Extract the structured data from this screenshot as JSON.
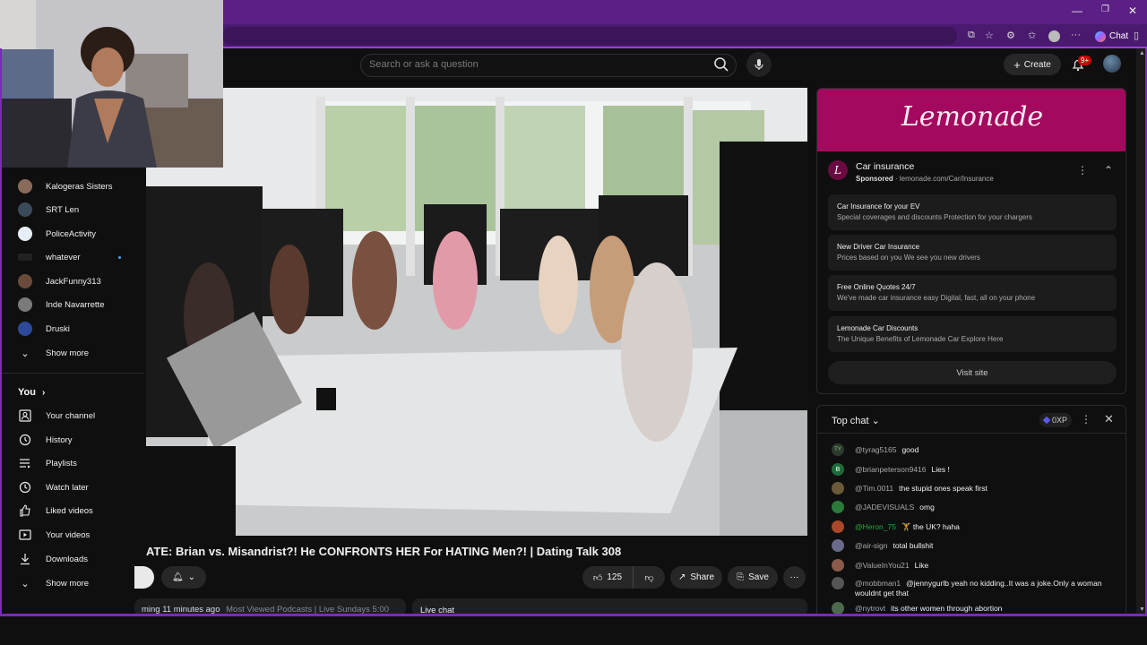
{
  "browser": {
    "chat_label": "Chat",
    "window_controls": [
      "—",
      "❐",
      "✕"
    ]
  },
  "header": {
    "search_placeholder": "Search or ask a question",
    "create_label": "Create",
    "notif_count": "9+"
  },
  "sidebar": {
    "subscriptions": [
      {
        "label": "Kalogeras Sisters",
        "color": "#8a6a5a"
      },
      {
        "label": "SRT Len",
        "color": "#3a4a5a"
      },
      {
        "label": "PoliceActivity",
        "color": "#e8eef8"
      },
      {
        "label": "whatever",
        "color": "#222222",
        "live": true
      },
      {
        "label": "JackFunny313",
        "color": "#6a4a3a"
      },
      {
        "label": "Inde Navarrette",
        "color": "#7a7a7a"
      },
      {
        "label": "Druski",
        "color": "#2b4a9a"
      }
    ],
    "show_more_1": "Show more",
    "you_heading": "You",
    "you_items": [
      {
        "label": "Your channel",
        "icon": "person-icon"
      },
      {
        "label": "History",
        "icon": "history-icon"
      },
      {
        "label": "Playlists",
        "icon": "playlists-icon"
      },
      {
        "label": "Watch later",
        "icon": "clock-icon"
      },
      {
        "label": "Liked videos",
        "icon": "thumbs-up-icon"
      },
      {
        "label": "Your videos",
        "icon": "play-box-icon"
      },
      {
        "label": "Downloads",
        "icon": "download-icon"
      }
    ],
    "show_more_2": "Show more"
  },
  "video": {
    "title": "ATE: Brian vs. Misandrist?! He CONFRONTS HER For HATING Men?! | Dating Talk 308",
    "likes": "125",
    "share_label": "Share",
    "save_label": "Save",
    "meta_time": "ming 11 minutes ago",
    "meta_tags": "Most Viewed Podcasts | Live Sundays 5:00",
    "live_chat_label": "Live chat"
  },
  "ad": {
    "brand": "Lemonade",
    "badge": "L",
    "title": "Car insurance",
    "sponsored": "Sponsored",
    "domain": "lemonade.com/Car/Insurance",
    "cards": [
      {
        "h": "Car Insurance for your EV",
        "d": "Special coverages and discounts Protection for your chargers"
      },
      {
        "h": "New Driver Car Insurance",
        "d": "Prices based on you We see you new drivers"
      },
      {
        "h": "Free Online Quotes 24/7",
        "d": "We've made car insurance easy Digital, fast, all on your phone"
      },
      {
        "h": "Lemonade Car Discounts",
        "d": "The Unique Benefits of Lemonade Car Explore Here"
      }
    ],
    "visit_label": "Visit site"
  },
  "chat": {
    "heading": "Top chat",
    "xp": "0XP",
    "messages": [
      {
        "user": "@tyrag5165",
        "text": "good",
        "color": "#2d3a2d",
        "initial": "TY"
      },
      {
        "user": "@brianpeterson9416",
        "text": "Lies !",
        "color": "#1e6b3a",
        "initial": "B"
      },
      {
        "user": "@Tim.0011",
        "text": "the stupid ones speak first",
        "color": "#6a5a3a"
      },
      {
        "user": "@JADEVISUALS",
        "text": "omg",
        "color": "#2a7a3a"
      },
      {
        "user": "@Heron_75",
        "text": "🏋 the UK? haha",
        "color": "#a84a2a",
        "green": true
      },
      {
        "user": "@air-sign",
        "text": "total bullshit",
        "color": "#6a6a8a"
      },
      {
        "user": "@ValueInYou21",
        "text": "Like",
        "color": "#8a5a4a"
      },
      {
        "user": "@mobbman1",
        "text": "@jennygurlb yeah no kidding..It was a joke.Only a woman wouldnt get that",
        "color": "#555555"
      },
      {
        "user": "@nytrovt",
        "text": "its other women through abortion",
        "color": "#4a6a4a"
      }
    ]
  }
}
